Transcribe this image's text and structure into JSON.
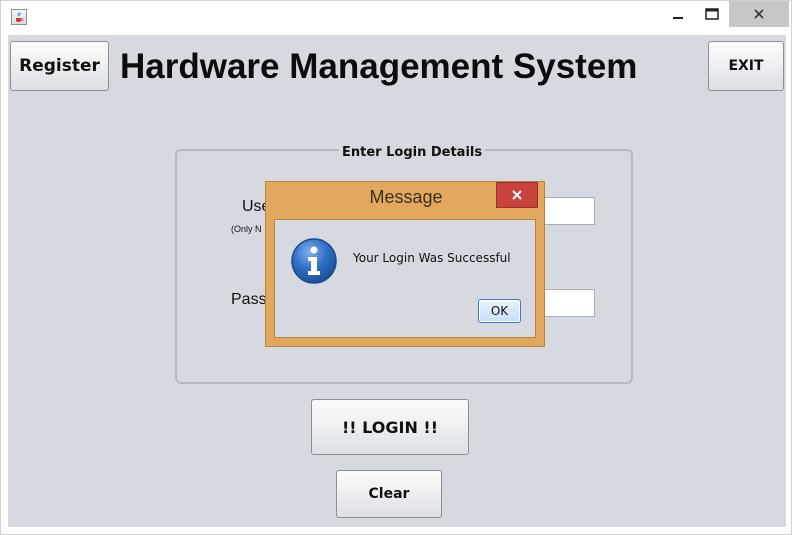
{
  "window": {
    "icon": "java-coffee-icon",
    "controls": {
      "minimize_icon": "minimize-icon",
      "maximize_icon": "maximize-icon",
      "close_icon": "close-icon"
    }
  },
  "header": {
    "register_label": "Register",
    "title": "Hardware Management System",
    "exit_label": "EXIT"
  },
  "login_panel": {
    "legend": "Enter Login Details",
    "username_label": "Use",
    "username_hint": "(Only N",
    "username_value": "",
    "password_label": "Pass",
    "password_value": ""
  },
  "actions": {
    "login_label": "!! LOGIN !!",
    "clear_label": "Clear"
  },
  "dialog": {
    "title": "Message",
    "message": "Your Login Was Successful",
    "ok_label": "OK",
    "icon": "info-icon"
  },
  "colors": {
    "content_bg": "#d6d9df",
    "dialog_frame": "#e1a85e",
    "dialog_close": "#c8423e",
    "info_blue": "#2f6fc4"
  }
}
